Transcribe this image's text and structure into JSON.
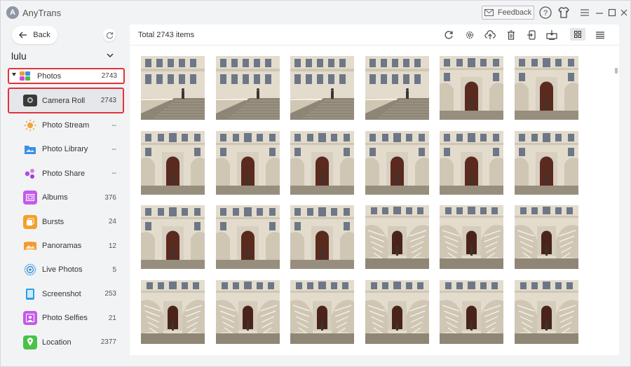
{
  "app": {
    "title": "AnyTrans",
    "feedback_label": "Feedback"
  },
  "titlebar_icons": [
    "mail-icon",
    "help-icon",
    "shirt-icon",
    "menu-icon",
    "minimize-icon",
    "maximize-icon",
    "close-icon"
  ],
  "sidebar": {
    "back_label": "Back",
    "device_name": "lulu",
    "photos": {
      "label": "Photos",
      "count": "2743"
    },
    "items": [
      {
        "label": "Camera Roll",
        "count": "2743",
        "icon": "camera-icon",
        "selected": true
      },
      {
        "label": "Photo Stream",
        "count": "--",
        "icon": "photo-stream-icon",
        "color": "#f2a33a"
      },
      {
        "label": "Photo Library",
        "count": "--",
        "icon": "photo-library-icon",
        "color": "#3b8fe0"
      },
      {
        "label": "Photo Share",
        "count": "--",
        "icon": "photo-share-icon",
        "color": "#b44ee0"
      },
      {
        "label": "Albums",
        "count": "376",
        "icon": "albums-icon",
        "color": "#c45ae8"
      },
      {
        "label": "Bursts",
        "count": "24",
        "icon": "bursts-icon",
        "color": "#f5a02a"
      },
      {
        "label": "Panoramas",
        "count": "12",
        "icon": "panoramas-icon",
        "color": "#f59a2e"
      },
      {
        "label": "Live Photos",
        "count": "5",
        "icon": "live-photos-icon",
        "color": "#2f8fe0"
      },
      {
        "label": "Screenshot",
        "count": "253",
        "icon": "screenshot-icon",
        "color": "#2aa0e8"
      },
      {
        "label": "Photo Selfies",
        "count": "21",
        "icon": "selfies-icon",
        "color": "#c45ae8"
      },
      {
        "label": "Location",
        "count": "2377",
        "icon": "location-icon",
        "color": "#48c248"
      }
    ]
  },
  "main": {
    "total_label": "Total 2743 items",
    "toolbar": [
      "refresh-icon",
      "settings-icon",
      "upload-icon",
      "delete-icon",
      "export-to-device-icon",
      "download-to-computer-icon",
      "grid-view-icon",
      "list-view-icon"
    ],
    "photo_count_visible": 24,
    "photo_variants": [
      "staircase-side",
      "staircase-side",
      "staircase-side",
      "staircase-side",
      "door-front",
      "door-front",
      "door-front",
      "door-front",
      "door-front",
      "door-front",
      "door-front",
      "door-front",
      "door-front",
      "door-front",
      "door-front",
      "staircase-front",
      "staircase-front",
      "staircase-front",
      "staircase-front",
      "staircase-front",
      "staircase-front",
      "staircase-front",
      "staircase-front",
      "staircase-front"
    ]
  },
  "colors": {
    "highlight_border": "#e0333a",
    "window_bg": "#f2f3f5",
    "selected_bg": "#e6e7ea"
  }
}
